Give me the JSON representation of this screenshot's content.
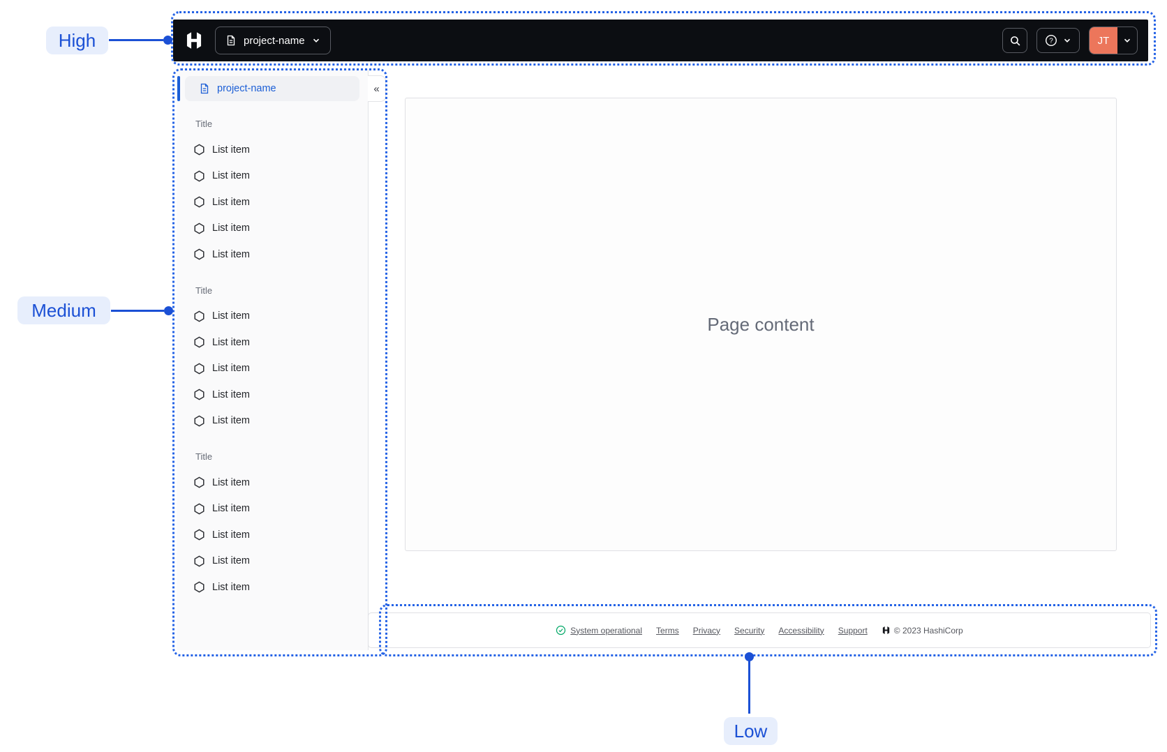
{
  "annotations": {
    "high": "High",
    "medium": "Medium",
    "low": "Low"
  },
  "navbar": {
    "project_switcher_label": "project-name",
    "account_initials": "JT",
    "icons": {
      "logo": "hashicorp-logo",
      "project": "file-text-icon",
      "search": "search-icon",
      "help": "help-circle-icon",
      "dropdown": "chevron-down-icon"
    }
  },
  "sidebar": {
    "project_label": "project-name",
    "collapse_glyph": "«",
    "item_icon": "hexagon-icon",
    "sections": [
      {
        "title": "Title",
        "items": [
          "List item",
          "List item",
          "List item",
          "List item",
          "List item"
        ]
      },
      {
        "title": "Title",
        "items": [
          "List item",
          "List item",
          "List item",
          "List item",
          "List item"
        ]
      },
      {
        "title": "Title",
        "items": [
          "List item",
          "List item",
          "List item",
          "List item",
          "List item"
        ]
      }
    ]
  },
  "main": {
    "placeholder": "Page content"
  },
  "footer": {
    "status_label": "System operational",
    "status_icon": "check-circle-icon",
    "links": [
      "Terms",
      "Privacy",
      "Security",
      "Accessibility",
      "Support"
    ],
    "copyright": "© 2023 HashiCorp"
  },
  "colors": {
    "annotation_blue": "#1b50d5",
    "dotted_border_blue": "#2563e6",
    "navbar_bg": "#0c0e12",
    "avatar_bg": "#ec765b",
    "active_link_blue": "#1c5fd6",
    "status_green": "#00a766"
  }
}
